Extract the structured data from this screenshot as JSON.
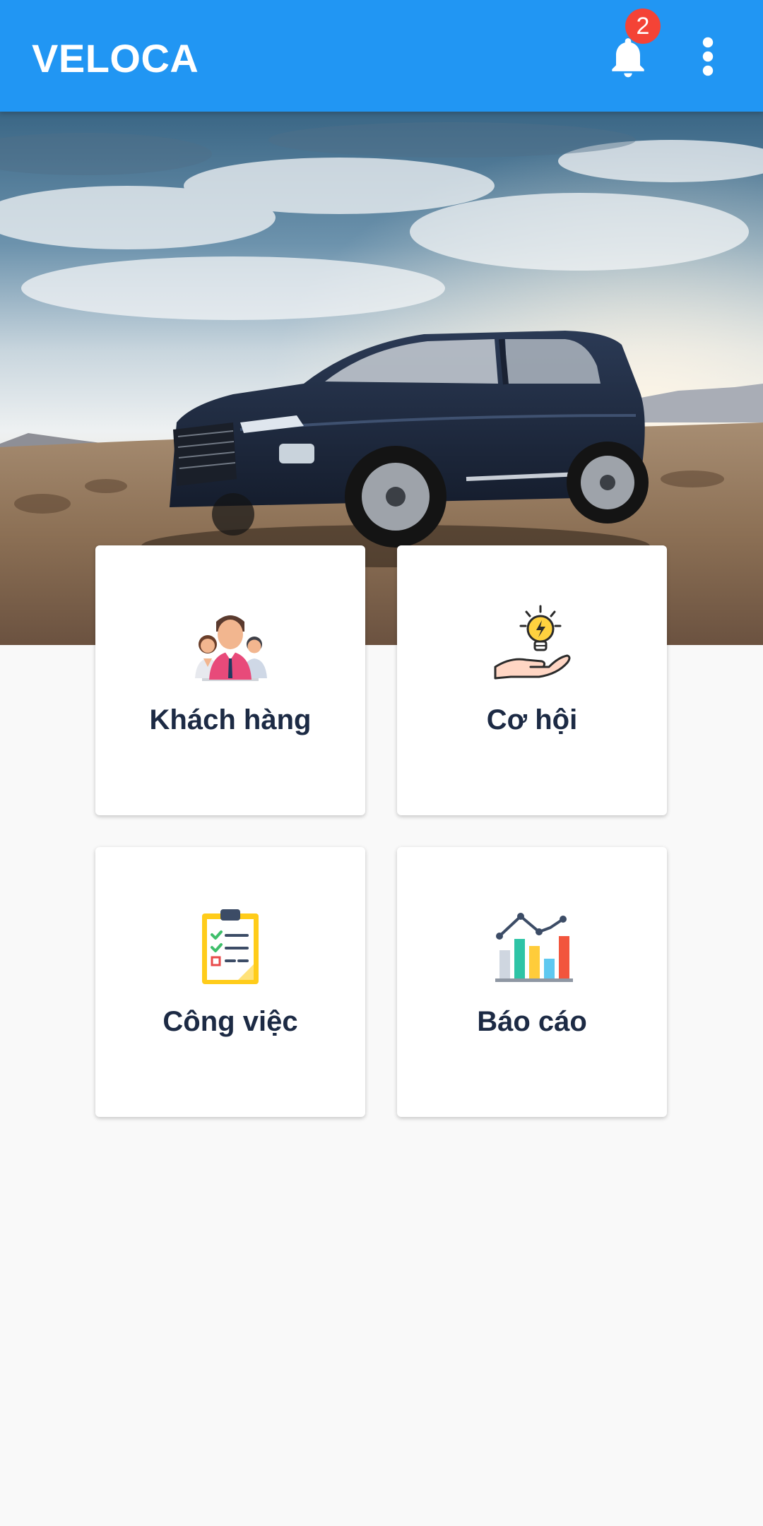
{
  "appbar": {
    "title": "VELOCA",
    "notification_count": "2",
    "color": "#2196f3"
  },
  "icons": {
    "notifications": "bell-icon",
    "menu": "more-vert-icon"
  },
  "tiles": [
    {
      "label": "Khách hàng",
      "icon": "customers-icon"
    },
    {
      "label": "Cơ hội",
      "icon": "opportunity-icon"
    },
    {
      "label": "Công việc",
      "icon": "tasks-icon"
    },
    {
      "label": "Báo cáo",
      "icon": "report-icon"
    }
  ]
}
